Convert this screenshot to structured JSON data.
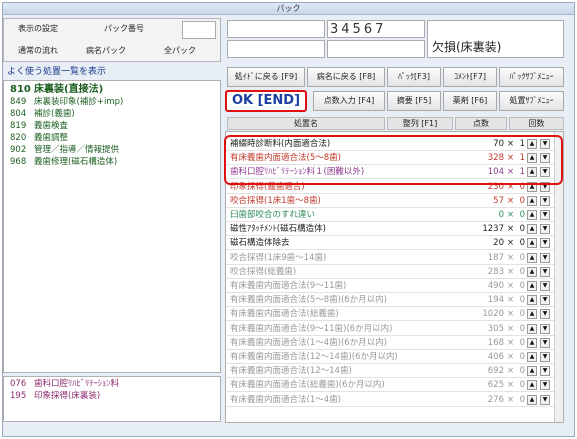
{
  "window": {
    "title": "パック"
  },
  "top_left": {
    "display_settings": "表示の設定",
    "pack_number_label": "パック番号",
    "normal_flow": "通常の流れ",
    "disease_pack": "病名パック",
    "all_pack": "全パック"
  },
  "patient": {
    "number": "34567",
    "name": "欠損(床裏装)"
  },
  "left": {
    "header": "よく使う処置一覧を表示",
    "items": [
      {
        "code": "810",
        "label": "床裏装(直接法)"
      },
      {
        "code": "849",
        "label": "床裏装印象(補診+imp)"
      },
      {
        "code": "804",
        "label": "補診(義歯)"
      },
      {
        "code": "819",
        "label": "義歯検査"
      },
      {
        "code": "820",
        "label": "義歯調整"
      },
      {
        "code": "902",
        "label": "管理／指導／情報提供"
      },
      {
        "code": "968",
        "label": "義歯修理(磁石構造体)"
      }
    ],
    "bottom_items": [
      {
        "code": "076",
        "label": "歯科口腔ﾘﾊﾋﾞﾘﾃｰｼｮﾝ料"
      },
      {
        "code": "195",
        "label": "印象採得(床裏装)"
      }
    ]
  },
  "toolbar": {
    "shochi_back": "処ｲﾄﾞに戻る [F9]",
    "byomei_back": "病名に戻る [F8]",
    "pack": "ﾊﾟｯｸ[F3]",
    "comment": "ｺﾒﾝﾄ[F7]",
    "pack_menu": "ﾊﾟｯｸｻﾌﾞﾒﾆｭｰ",
    "ok_end": "OK [END]",
    "points_input": "点数入力 [F4]",
    "summary": "摘要 [F5]",
    "drug": "薬剤 [F6]",
    "shochi_menu": "処置ｻﾌﾞﾒﾆｭｰ"
  },
  "table": {
    "col_name": "処置名",
    "col_sort": "整列 [F1]",
    "col_points": "点数",
    "col_count": "回数",
    "rows": [
      {
        "name": "補綴時診断料(内面適合法)",
        "points": "70",
        "qty": "1",
        "color": "#222222"
      },
      {
        "name": "有床義歯内面適合法(5〜8歯)",
        "points": "328",
        "qty": "1",
        "color": "#c0392b"
      },
      {
        "name": "歯科口腔ﾘﾊﾋﾞﾘﾃｰｼｮﾝ料１(困難以外)",
        "points": "104",
        "qty": "1",
        "color": "#8e3a8e"
      },
      {
        "name": "印象採得(義歯適合)",
        "points": "230",
        "qty": "0",
        "color": "#c0392b"
      },
      {
        "name": "咬合採得(1床1歯〜8歯)",
        "points": "57",
        "qty": "0",
        "color": "#c0392b"
      },
      {
        "name": "臼歯部咬合のすれ違い",
        "points": "0",
        "qty": "0",
        "color": "#2e8b57"
      },
      {
        "name": "磁性ｱﾀｯﾁﾒﾝﾄ(磁石構造体)",
        "points": "1237",
        "qty": "0",
        "color": "#222222"
      },
      {
        "name": "磁石構造体除去",
        "points": "20",
        "qty": "0",
        "color": "#222222"
      },
      {
        "name": "咬合採得(1床9歯〜14歯)",
        "points": "187",
        "qty": "0",
        "color": "#999999"
      },
      {
        "name": "咬合採得(総義歯)",
        "points": "283",
        "qty": "0",
        "color": "#999999"
      },
      {
        "name": "有床義歯内面適合法(9〜11歯)",
        "points": "490",
        "qty": "0",
        "color": "#999999"
      },
      {
        "name": "有床義歯内面適合法(5〜8歯)(6か月以内)",
        "points": "194",
        "qty": "0",
        "color": "#999999"
      },
      {
        "name": "有床義歯内面適合法(総義歯)",
        "points": "1020",
        "qty": "0",
        "color": "#999999"
      },
      {
        "name": "有床義歯内面適合法(9〜11歯)(6か月以内)",
        "points": "305",
        "qty": "0",
        "color": "#999999"
      },
      {
        "name": "有床義歯内面適合法(1〜4歯)(6か月以内)",
        "points": "168",
        "qty": "0",
        "color": "#999999"
      },
      {
        "name": "有床義歯内面適合法(12〜14歯)(6か月以内)",
        "points": "406",
        "qty": "0",
        "color": "#999999"
      },
      {
        "name": "有床義歯内面適合法(12〜14歯)",
        "points": "692",
        "qty": "0",
        "color": "#999999"
      },
      {
        "name": "有床義歯内面適合法(総義歯)(6か月以内)",
        "points": "625",
        "qty": "0",
        "color": "#999999"
      },
      {
        "name": "有床義歯内面適合法(1〜4歯)",
        "points": "276",
        "qty": "0",
        "color": "#999999"
      }
    ]
  },
  "accent": {
    "highlight": "#e01010",
    "ok_text": "#1a3fa0"
  }
}
